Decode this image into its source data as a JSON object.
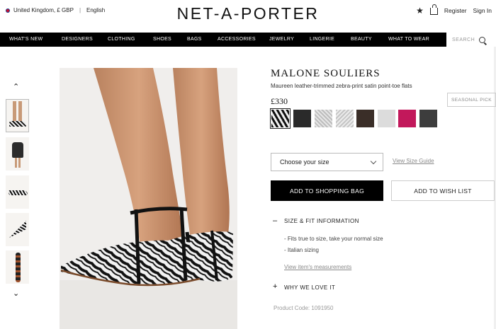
{
  "header": {
    "locale": "United Kingdom, £ GBP",
    "language": "English",
    "logo": "NET-A-PORTER",
    "register": "Register",
    "signin": "Sign In"
  },
  "nav": {
    "items": [
      "WHAT'S NEW",
      "DESIGNERS",
      "CLOTHING",
      "SHOES",
      "BAGS",
      "ACCESSORIES",
      "JEWELRY",
      "LINGERIE",
      "BEAUTY",
      "WHAT TO WEAR"
    ],
    "search_placeholder": "SEARCH"
  },
  "product": {
    "brand": "MALONE SOULIERS",
    "name": "Maureen leather-trimmed zebra-print satin point-toe flats",
    "price": "£330",
    "badge": "SEASONAL PICK",
    "swatch_colors": [
      "zebra",
      "#2a2a2a",
      "#cfcfcf",
      "#d8d8d8",
      "#3a2e28",
      "#dcdcdc",
      "#c2185b",
      "#3d3d3d"
    ]
  },
  "size": {
    "select_label": "Choose your size",
    "guide_link": "View Size Guide"
  },
  "buttons": {
    "add_to_bag": "ADD TO SHOPPING BAG",
    "add_to_wishlist": "ADD TO WISH LIST"
  },
  "details": {
    "size_fit_title": "SIZE & FIT INFORMATION",
    "size_fit_bullets": [
      "- Fits true to size, take your normal size",
      "- Italian sizing"
    ],
    "measurements_link": "View item's measurements",
    "why_love_title": "WHY WE LOVE IT",
    "product_code": "Product Code: 1091950"
  }
}
